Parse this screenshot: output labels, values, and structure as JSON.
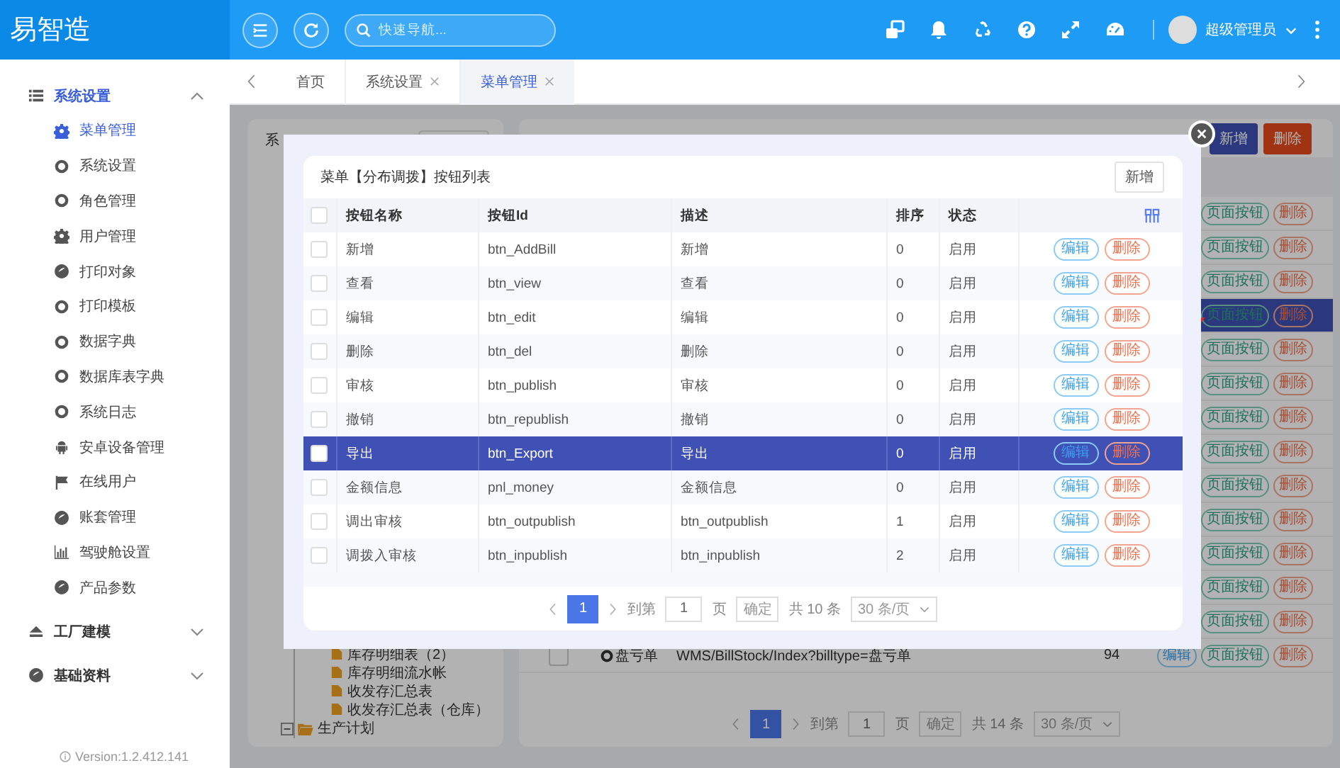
{
  "app": {
    "logo": "易智造"
  },
  "header": {
    "search": {
      "placeholder": "快速导航..."
    },
    "user": "超级管理员"
  },
  "sidebar": {
    "groups": [
      {
        "label": "系统设置",
        "expanded": true,
        "items": [
          {
            "label": "菜单管理",
            "selected": true
          },
          {
            "label": "系统设置",
            "selected": false
          },
          {
            "label": "角色管理",
            "selected": false
          },
          {
            "label": "用户管理",
            "selected": false
          },
          {
            "label": "打印对象",
            "selected": false
          },
          {
            "label": "打印模板",
            "selected": false
          },
          {
            "label": "数据字典",
            "selected": false
          },
          {
            "label": "数据库表字典",
            "selected": false
          },
          {
            "label": "系统日志",
            "selected": false
          },
          {
            "label": "安卓设备管理",
            "selected": false
          },
          {
            "label": "在线用户",
            "selected": false
          },
          {
            "label": "账套管理",
            "selected": false
          },
          {
            "label": "驾驶舱设置",
            "selected": false
          },
          {
            "label": "产品参数",
            "selected": false
          }
        ]
      },
      {
        "label": "工厂建模",
        "expanded": false
      },
      {
        "label": "基础资料",
        "expanded": false
      }
    ],
    "version": "Version:1.2.412.141"
  },
  "tabs": [
    {
      "label": "首页",
      "closable": false,
      "selected": false
    },
    {
      "label": "系统设置",
      "closable": true,
      "selected": false
    },
    {
      "label": "菜单管理",
      "closable": true,
      "selected": true
    }
  ],
  "background": {
    "tree_panel": {
      "title": "系",
      "leaves": [
        "库存明细表（2）",
        "库存明细流水帐",
        "收发存汇总表",
        "收发存汇总表（仓库）"
      ],
      "nodes": [
        {
          "label": "生产计划",
          "expanded": true
        }
      ]
    },
    "list_panel": {
      "buttons": [
        {
          "label": "新增",
          "kind": "primary"
        },
        {
          "label": "删除",
          "kind": "danger"
        }
      ],
      "rows": [
        {
          "selected": false,
          "actions": [
            {
              "label": "页面按钮",
              "kind": "page"
            },
            {
              "label": "删除",
              "kind": "delete"
            }
          ]
        },
        {
          "selected": false,
          "actions": [
            {
              "label": "页面按钮",
              "kind": "page"
            },
            {
              "label": "删除",
              "kind": "delete"
            }
          ]
        },
        {
          "selected": false,
          "actions": [
            {
              "label": "页面按钮",
              "kind": "page"
            },
            {
              "label": "删除",
              "kind": "delete"
            }
          ]
        },
        {
          "selected": true,
          "actions": [
            {
              "label": "页面按钮",
              "kind": "page"
            },
            {
              "label": "删除",
              "kind": "delete"
            }
          ]
        },
        {
          "selected": false,
          "actions": [
            {
              "label": "页面按钮",
              "kind": "page"
            },
            {
              "label": "删除",
              "kind": "delete"
            }
          ]
        },
        {
          "selected": false,
          "actions": [
            {
              "label": "页面按钮",
              "kind": "page"
            },
            {
              "label": "删除",
              "kind": "delete"
            }
          ]
        },
        {
          "selected": false,
          "actions": [
            {
              "label": "页面按钮",
              "kind": "page"
            },
            {
              "label": "删除",
              "kind": "delete"
            }
          ]
        },
        {
          "selected": false,
          "actions": [
            {
              "label": "页面按钮",
              "kind": "page"
            },
            {
              "label": "删除",
              "kind": "delete"
            }
          ]
        },
        {
          "selected": false,
          "actions": [
            {
              "label": "页面按钮",
              "kind": "page"
            },
            {
              "label": "删除",
              "kind": "delete"
            }
          ]
        },
        {
          "selected": false,
          "actions": [
            {
              "label": "页面按钮",
              "kind": "page"
            },
            {
              "label": "删除",
              "kind": "delete"
            }
          ]
        },
        {
          "selected": false,
          "actions": [
            {
              "label": "页面按钮",
              "kind": "page"
            },
            {
              "label": "删除",
              "kind": "delete"
            }
          ]
        },
        {
          "selected": false,
          "actions": [
            {
              "label": "页面按钮",
              "kind": "page"
            },
            {
              "label": "删除",
              "kind": "delete"
            }
          ]
        },
        {
          "selected": false,
          "actions": [
            {
              "label": "页面按钮",
              "kind": "page"
            },
            {
              "label": "删除",
              "kind": "delete"
            }
          ]
        },
        {
          "selected": false,
          "checked": false,
          "name": "盘亏单",
          "path": "WMS/BillStock/Index?billtype=盘亏单",
          "order": "94",
          "actions": [
            {
              "label": "编辑",
              "kind": "edit"
            },
            {
              "label": "页面按钮",
              "kind": "page"
            },
            {
              "label": "删除",
              "kind": "delete"
            }
          ]
        }
      ],
      "pagination": {
        "pages": [
          {
            "label": "1",
            "selected": true
          }
        ],
        "goto_label": "到第",
        "page_input": "1",
        "page_unit": "页",
        "confirm": "确定",
        "total": "共 14 条",
        "page_size": "30 条/页"
      }
    }
  },
  "modal": {
    "title": "菜单【分布调拨】按钮列表",
    "add_button": "新增",
    "header_checked": false,
    "columns": [
      "按钮名称",
      "按钮Id",
      "描述",
      "排序",
      "状态"
    ],
    "rows": [
      {
        "name": "新增",
        "id": "btn_AddBill",
        "desc": "新增",
        "order": "0",
        "status": "启用",
        "checked": false,
        "selected": false,
        "actions": [
          {
            "label": "编辑",
            "kind": "edit"
          },
          {
            "label": "删除",
            "kind": "delete"
          }
        ]
      },
      {
        "name": "查看",
        "id": "btn_view",
        "desc": "查看",
        "order": "0",
        "status": "启用",
        "checked": false,
        "selected": false,
        "actions": [
          {
            "label": "编辑",
            "kind": "edit"
          },
          {
            "label": "删除",
            "kind": "delete"
          }
        ]
      },
      {
        "name": "编辑",
        "id": "btn_edit",
        "desc": "编辑",
        "order": "0",
        "status": "启用",
        "checked": false,
        "selected": false,
        "actions": [
          {
            "label": "编辑",
            "kind": "edit"
          },
          {
            "label": "删除",
            "kind": "delete"
          }
        ]
      },
      {
        "name": "删除",
        "id": "btn_del",
        "desc": "删除",
        "order": "0",
        "status": "启用",
        "checked": false,
        "selected": false,
        "actions": [
          {
            "label": "编辑",
            "kind": "edit"
          },
          {
            "label": "删除",
            "kind": "delete"
          }
        ]
      },
      {
        "name": "审核",
        "id": "btn_publish",
        "desc": "审核",
        "order": "0",
        "status": "启用",
        "checked": false,
        "selected": false,
        "actions": [
          {
            "label": "编辑",
            "kind": "edit"
          },
          {
            "label": "删除",
            "kind": "delete"
          }
        ]
      },
      {
        "name": "撤销",
        "id": "btn_republish",
        "desc": "撤销",
        "order": "0",
        "status": "启用",
        "checked": false,
        "selected": false,
        "actions": [
          {
            "label": "编辑",
            "kind": "edit"
          },
          {
            "label": "删除",
            "kind": "delete"
          }
        ]
      },
      {
        "name": "导出",
        "id": "btn_Export",
        "desc": "导出",
        "order": "0",
        "status": "启用",
        "checked": false,
        "selected": true,
        "actions": [
          {
            "label": "编辑",
            "kind": "edit"
          },
          {
            "label": "删除",
            "kind": "delete"
          }
        ]
      },
      {
        "name": "金额信息",
        "id": "pnl_money",
        "desc": "金额信息",
        "order": "0",
        "status": "启用",
        "checked": false,
        "selected": false,
        "actions": [
          {
            "label": "编辑",
            "kind": "edit"
          },
          {
            "label": "删除",
            "kind": "delete"
          }
        ]
      },
      {
        "name": "调出审核",
        "id": "btn_outpublish",
        "desc": "btn_outpublish",
        "order": "1",
        "status": "启用",
        "checked": false,
        "selected": false,
        "actions": [
          {
            "label": "编辑",
            "kind": "edit"
          },
          {
            "label": "删除",
            "kind": "delete"
          }
        ]
      },
      {
        "name": "调拨入审核",
        "id": "btn_inpublish",
        "desc": "btn_inpublish",
        "order": "2",
        "status": "启用",
        "checked": false,
        "selected": false,
        "actions": [
          {
            "label": "编辑",
            "kind": "edit"
          },
          {
            "label": "删除",
            "kind": "delete"
          }
        ]
      }
    ],
    "pagination": {
      "pages": [
        {
          "label": "1",
          "selected": true
        }
      ],
      "goto_label": "到第",
      "page_input": "1",
      "page_unit": "页",
      "confirm": "确定",
      "total": "共 10 条",
      "page_size": "30 条/页"
    }
  }
}
